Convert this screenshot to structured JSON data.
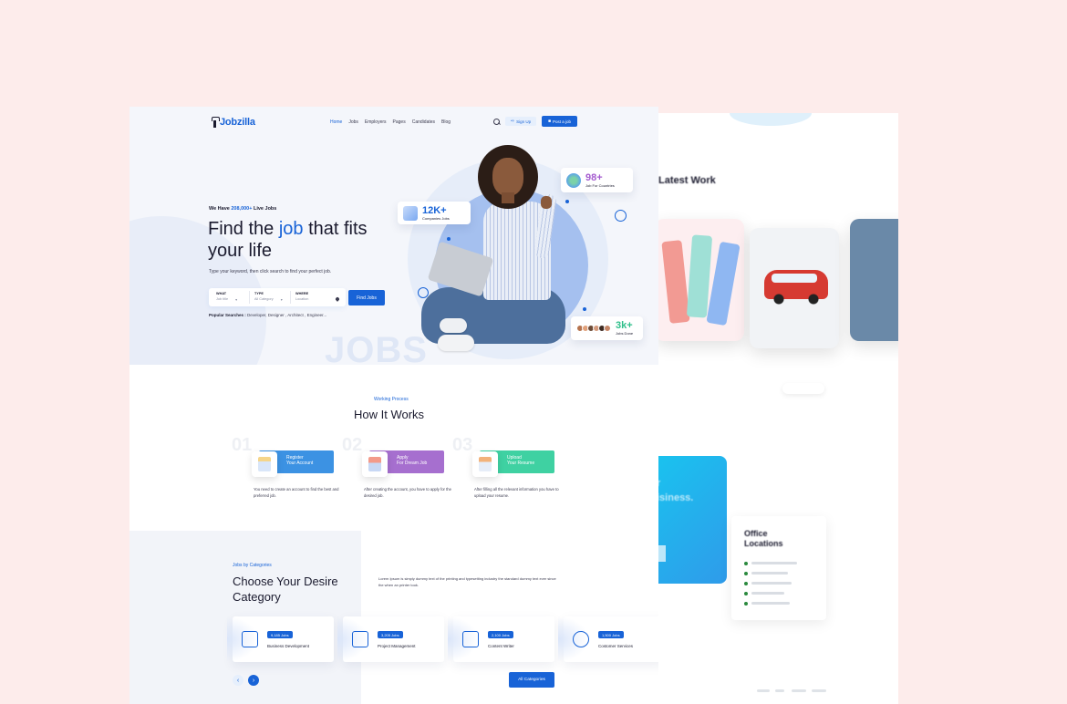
{
  "brand": {
    "name": "Jobzilla",
    "primary": "#1863d7",
    "background": "#fdeceb"
  },
  "nav": {
    "items": [
      "Home",
      "Jobs",
      "Employers",
      "Pages",
      "Candidates",
      "Blog"
    ],
    "active": "Home",
    "signup_label": "Sign Up",
    "post_label": "Post a job"
  },
  "hero": {
    "live_prefix": "We Have ",
    "live_count": "208,000+",
    "live_suffix": " Live Jobs",
    "title_before": "Find the ",
    "title_highlight": "job",
    "title_after": " that fits your life",
    "subtitle": "Type your keyword, then click search to find your perfect job.",
    "search": {
      "what_label": "WHAT",
      "what_value": "Job title",
      "type_label": "TYPE",
      "type_value": "All Category",
      "where_label": "WHERE",
      "where_value": "Location",
      "button": "Find Jobs"
    },
    "popular_label": "Popular Searches :",
    "popular_value": " Developer, Designer , Architect , Engineer...",
    "watermark": "JOBS",
    "badges": [
      {
        "number": "12K+",
        "caption": "Companies Jobs"
      },
      {
        "number": "98+",
        "caption": "Job For Countries"
      },
      {
        "number": "3k+",
        "caption": "Jobs Done"
      }
    ]
  },
  "how": {
    "subtitle": "Working Process",
    "title": "How It Works",
    "steps": [
      {
        "no": "01",
        "line1": "Register",
        "line2": "Your Account",
        "desc": "You need to create an account to find the best and preferred job.",
        "color": "#3c92e3"
      },
      {
        "no": "02",
        "line1": "Apply",
        "line2": "For Dream Job",
        "desc": "After creating the account, you have to apply for the desired job.",
        "color": "#a66fcf"
      },
      {
        "no": "03",
        "line1": "Upload",
        "line2": "Your Resume",
        "desc": "After filling all the relevant information you have to upload your resume.",
        "color": "#3fd1a2"
      }
    ]
  },
  "categories": {
    "subtitle": "Jobs by Categories",
    "title": "Choose Your Desire Category",
    "description": "Lorem Ipsum is simply dummy text of the printing and typesetting industry the standard dummy text ever since the when an printer took.",
    "items": [
      {
        "count": "9,185 Jobs",
        "name": "Business Development"
      },
      {
        "count": "3,205 Jobs",
        "name": "Project Management"
      },
      {
        "count": "2,100 Jobs",
        "name": "Content Writer"
      },
      {
        "count": "1,500 Jobs",
        "name": "Costomer Services"
      }
    ],
    "all_label": "All Categories",
    "prev_icon": "chevron-left-icon",
    "next_icon": "chevron-right-icon"
  },
  "back_page": {
    "title": "Latest Work",
    "cta_text": "r\nisiness.",
    "office_title": "Office\nLocations"
  }
}
